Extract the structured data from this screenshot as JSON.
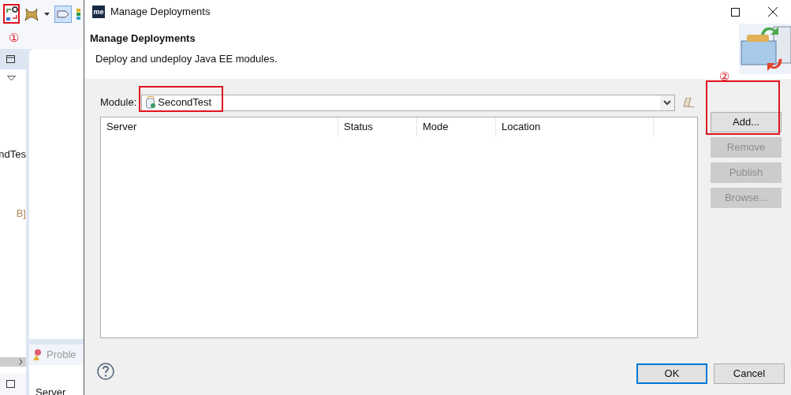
{
  "ide": {
    "left_panel": {
      "items": [
        {
          "text": "ndTes",
          "kind": "plain"
        },
        {
          "text": "B]",
          "kind": "decorated"
        }
      ]
    },
    "bottom_tab": {
      "label": "Proble"
    },
    "bottom_panel": {
      "text": "Server"
    }
  },
  "annotations": [
    {
      "label": "①"
    },
    {
      "label": "②"
    }
  ],
  "dialog": {
    "title": "Manage Deployments",
    "logo": "me",
    "heading": "Manage Deployments",
    "description": "Deploy and undeploy Java EE modules.",
    "module": {
      "label": "Module:",
      "value": "SecondTest"
    },
    "table": {
      "columns": [
        "Server",
        "Status",
        "Mode",
        "Location"
      ]
    },
    "side_buttons": [
      {
        "label": "Add...",
        "disabled": false
      },
      {
        "label": "Remove",
        "disabled": true
      },
      {
        "label": "Publish",
        "disabled": true
      },
      {
        "label": "Browse...",
        "disabled": true
      }
    ],
    "footer_buttons": [
      {
        "label": "OK",
        "default": true
      },
      {
        "label": "Cancel",
        "default": false
      }
    ]
  }
}
